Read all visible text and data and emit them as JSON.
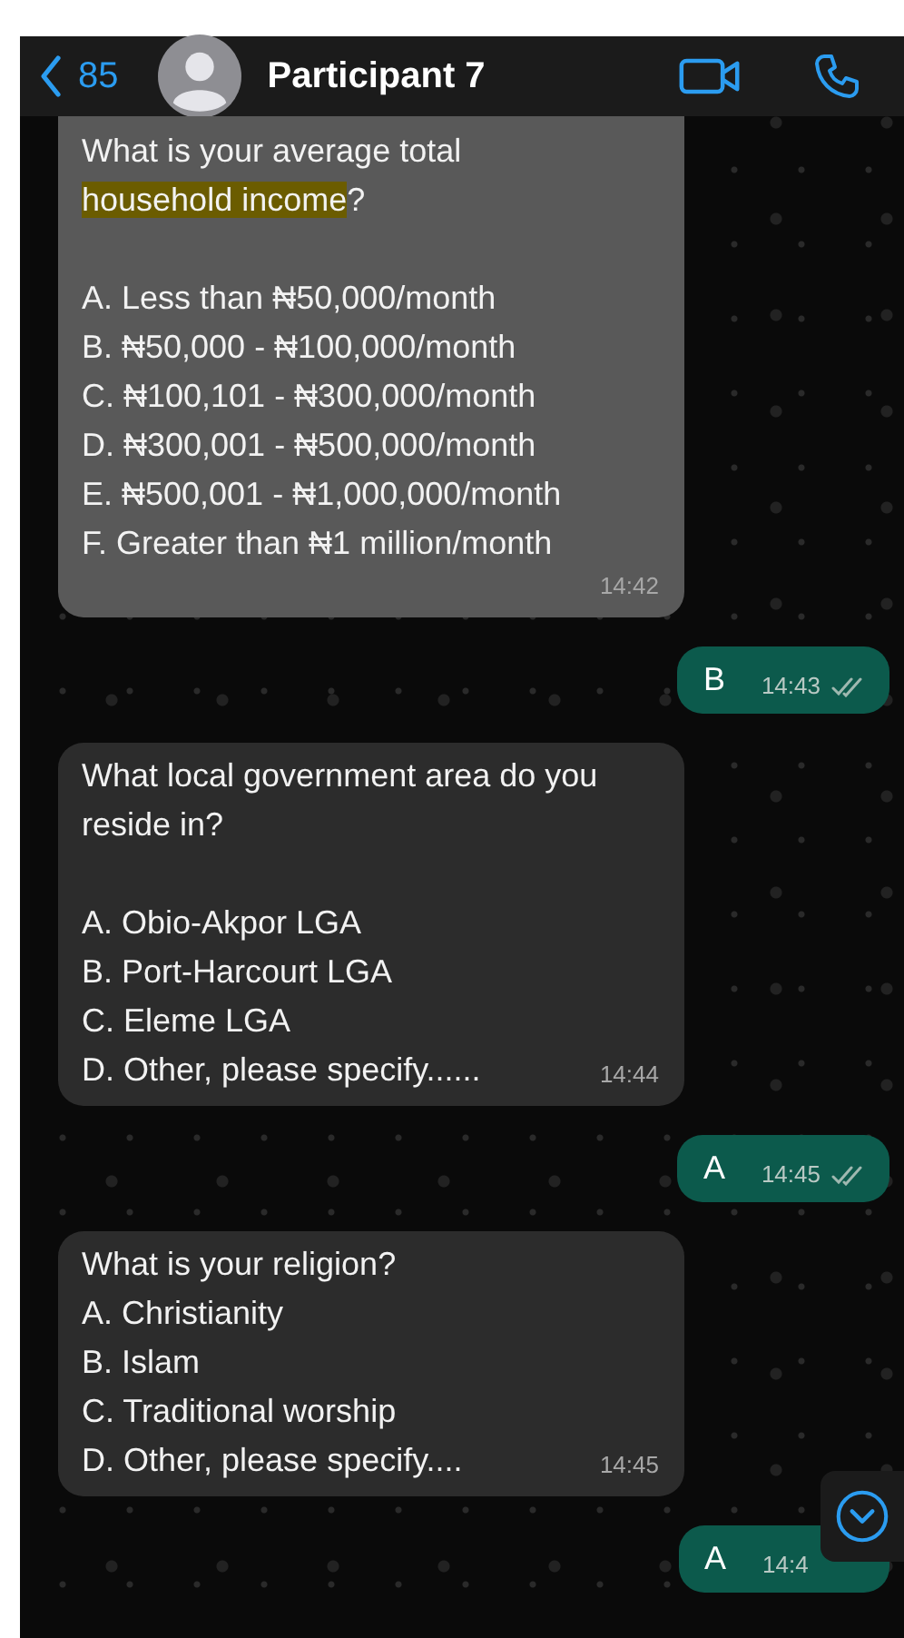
{
  "header": {
    "back_count": "85",
    "contact_name": "Participant 7"
  },
  "messages": [
    {
      "kind": "incoming",
      "question": [
        [
          {
            "text": "What is your average total",
            "highlighted": false
          }
        ],
        [
          {
            "text": "household income",
            "highlighted": true
          },
          {
            "text": "?",
            "highlighted": false
          }
        ]
      ],
      "spaced": true,
      "options": [
        "A. Less than ₦50,000/month",
        "B. ₦50,000 - ₦100,000/month",
        "C. ₦100,101 - ₦300,000/month",
        "D. ₦300,001 - ₦500,000/month",
        "E. ₦500,001 - ₦1,000,000/month",
        "F. Greater than ₦1 million/month"
      ],
      "time": "14:42"
    },
    {
      "kind": "outgoing",
      "text": "B",
      "time": "14:43",
      "delivered": true
    },
    {
      "kind": "incoming",
      "question": [
        [
          {
            "text": "What local government area do you",
            "highlighted": false
          }
        ],
        [
          {
            "text": "reside in?",
            "highlighted": false
          }
        ]
      ],
      "spaced": true,
      "options": [
        "A. Obio-Akpor LGA",
        "B. Port-Harcourt LGA",
        "C. Eleme LGA",
        "D. Other, please specify......"
      ],
      "time": "14:44"
    },
    {
      "kind": "outgoing",
      "text": "A",
      "time": "14:45",
      "delivered": true
    },
    {
      "kind": "incoming",
      "question": [
        [
          {
            "text": "What is your religion?",
            "highlighted": false
          }
        ]
      ],
      "spaced": false,
      "options": [
        "A. Christianity",
        "B. Islam",
        "C. Traditional worship",
        "D. Other, please specify...."
      ],
      "time": "14:45"
    },
    {
      "kind": "outgoing",
      "text": "A",
      "time": "14:4",
      "delivered": false
    }
  ]
}
